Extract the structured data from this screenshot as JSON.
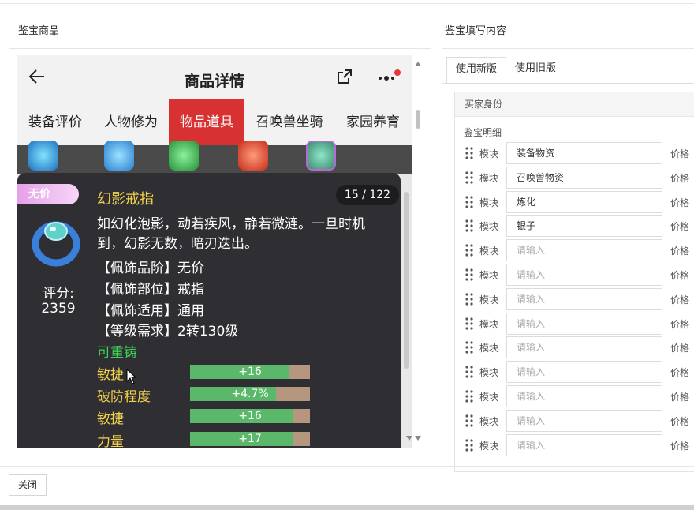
{
  "left_panel": {
    "title": "鉴宝商品"
  },
  "right_panel": {
    "title": "鉴宝填写内容"
  },
  "phone": {
    "header_title": "商品详情",
    "tabs": [
      {
        "label": "装备评价",
        "active": false
      },
      {
        "label": "人物修为",
        "active": false
      },
      {
        "label": "物品道具",
        "active": true
      },
      {
        "label": "召唤兽坐骑",
        "active": false
      },
      {
        "label": "家园养育",
        "active": false
      }
    ],
    "notification_dot_color": "#e53935"
  },
  "item": {
    "badge": "无价",
    "name": "幻影戒指",
    "pager": "15 / 122",
    "description": "如幻化泡影，动若疾风，静若微涟。一旦时机到，幻影无数，暗刃迭出。",
    "score_label": "评分:",
    "score_value": "2359",
    "attributes": [
      "【佩饰品阶】无价",
      "【佩饰部位】戒指",
      "【佩饰适用】通用",
      "【等级需求】2转130级"
    ],
    "reforge": "可重铸",
    "stats": [
      {
        "name": "敏捷",
        "value": "+16",
        "fill_fraction": 0.82
      },
      {
        "name": "破防程度",
        "value": "+4.7%",
        "fill_fraction": 0.72
      },
      {
        "name": "敏捷",
        "value": "+16",
        "fill_fraction": 0.86
      },
      {
        "name": "力量",
        "value": "+17",
        "fill_fraction": 0.86
      }
    ]
  },
  "form": {
    "tabs": [
      {
        "label": "使用新版",
        "active": true
      },
      {
        "label": "使用旧版",
        "active": false
      }
    ],
    "buyer_section": "买家身份",
    "detail_section": "鉴宝明细",
    "module_label": "模块",
    "price_label": "价格",
    "placeholder": "请输入",
    "rows": [
      "装备物资",
      "召唤兽物资",
      "炼化",
      "银子",
      "",
      "",
      "",
      "",
      "",
      "",
      "",
      "",
      ""
    ]
  },
  "footer": {
    "close_label": "关闭"
  },
  "colors": {
    "active_tab": "#d73131",
    "item_name": "#f2d14c",
    "reforge": "#3ed15a",
    "stat_fill": "#5bb86b",
    "stat_track": "#b5967f"
  }
}
